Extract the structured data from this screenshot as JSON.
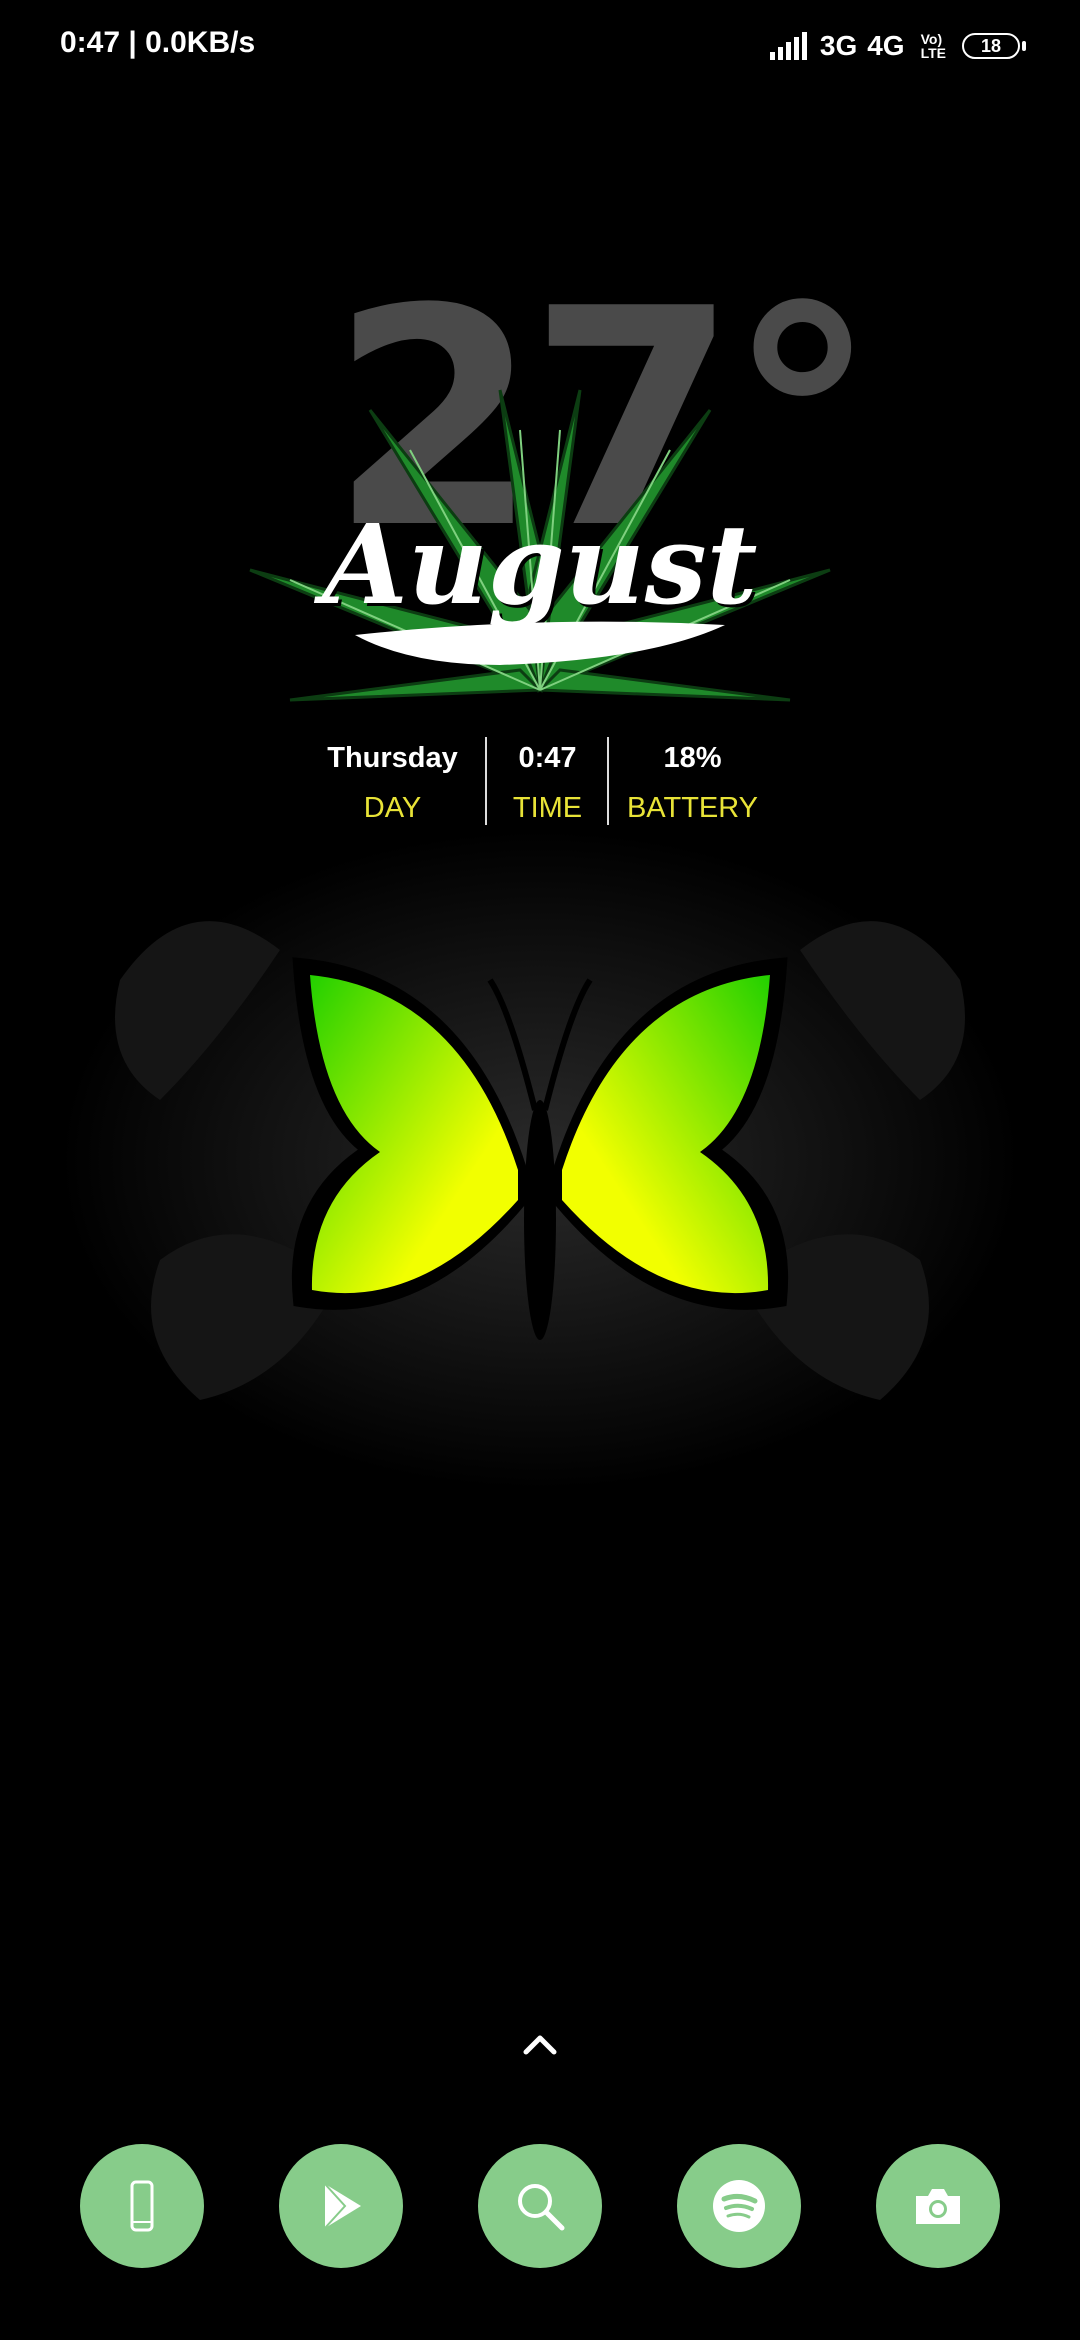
{
  "status_bar": {
    "time_speed": "0:47 | 0.0KB/s",
    "net1": "3G",
    "net2": "4G",
    "volte_top": "Vo)",
    "volte_bottom": "LTE",
    "battery": "18"
  },
  "widget": {
    "temperature": "27°",
    "month": "August",
    "day_value": "Thursday",
    "day_label": "DAY",
    "time_value": "0:47",
    "time_label": "TIME",
    "battery_value": "18%",
    "battery_label": "BATTERY",
    "accent_color": "#e8e337"
  },
  "dock": {
    "color": "#87cc8a",
    "items": [
      {
        "icon": "phone-icon"
      },
      {
        "icon": "play-store-icon"
      },
      {
        "icon": "search-icon"
      },
      {
        "icon": "spotify-icon"
      },
      {
        "icon": "camera-icon"
      }
    ]
  }
}
